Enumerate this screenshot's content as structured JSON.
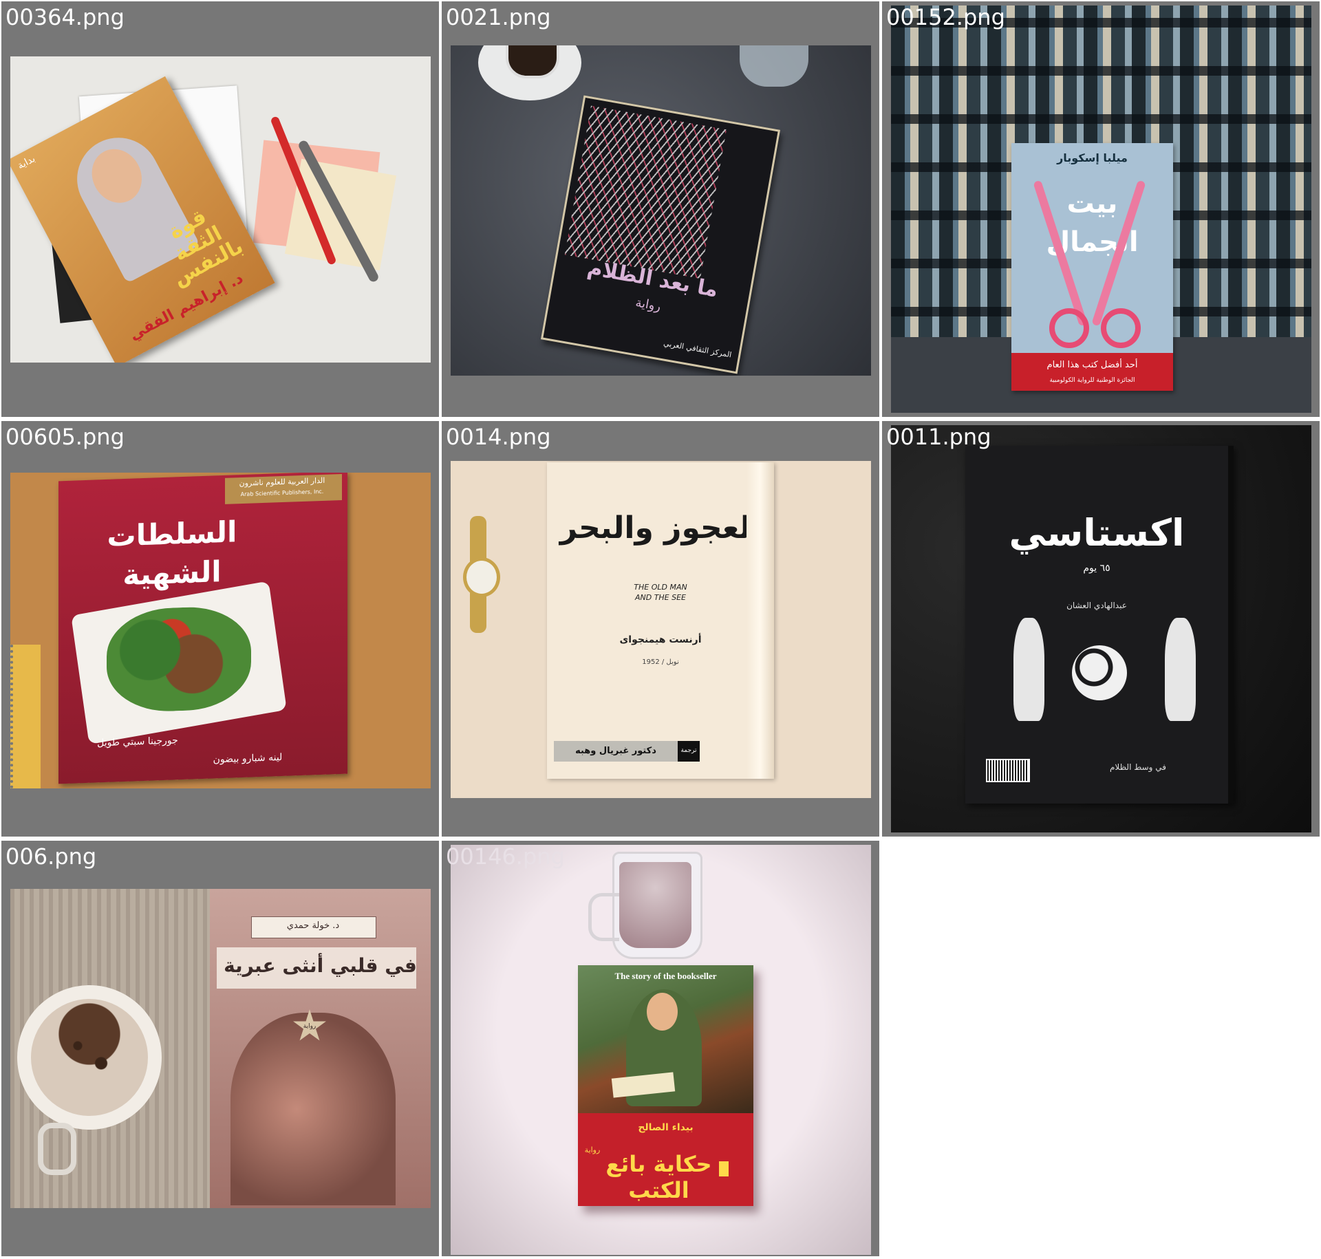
{
  "tiles": [
    {
      "filename": "00364.png",
      "publisher": "بداية",
      "title": "قوة الثقة بالنفس",
      "author": "د. إبراهيم الفقي"
    },
    {
      "filename": "0021.png",
      "title": "ما بعد الظلام",
      "genre": "رواية",
      "publisher": "المركز الثقافي العربي"
    },
    {
      "filename": "00152.png",
      "author": "ميلبا إسكوبار",
      "title": "بيت الجمال",
      "blurb": "أحد أفضل كتب هذا العام",
      "prize": "الجائزة الوطنية للرواية الكولومبية"
    },
    {
      "filename": "00605.png",
      "publisher": "الدار العربية للعلوم ناشرون",
      "publisher_en": "Arab Scientific Publishers, Inc.",
      "title": "السلطات الشهية",
      "author1": "جورجينا سبتي طويل",
      "author2": "لينه شبارو بيضون"
    },
    {
      "filename": "0014.png",
      "title": "العجوز والبحر",
      "title_en_line1": "THE OLD MAN",
      "title_en_line2": "AND THE SEE",
      "author": "أرنست هيمنجواى",
      "prize": "نوبل / 1952",
      "translation_label": "ترجمة",
      "translator": "دكتور غبريال وهبه"
    },
    {
      "filename": "0011.png",
      "title": "اكستاسي",
      "subtitle": "٦٥ يوم",
      "author": "عبدالهادي العشان",
      "tagline": "في وسط الظلام"
    },
    {
      "filename": "006.png",
      "author": "د. خولة حمدي",
      "title": "في قلبي أنثى عبرية",
      "badge": "رواية"
    },
    {
      "filename": "00146.png",
      "title_en": "The story of the bookseller",
      "author": "بيداء الصالح",
      "title": "حكاية بائع الكتب",
      "genre": "رواية"
    }
  ],
  "colors": {
    "tile_background": "#777777",
    "page_background": "#ffffff",
    "label_text": "#ffffff"
  }
}
